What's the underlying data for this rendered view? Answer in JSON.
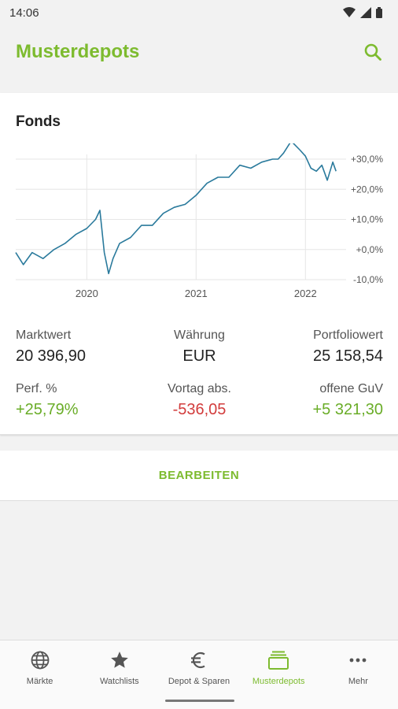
{
  "status": {
    "time": "14:06"
  },
  "header": {
    "title": "Musterdepots"
  },
  "card": {
    "title": "Fonds",
    "stats": [
      {
        "label": "Marktwert",
        "value": "20 396,90",
        "tone": "neutral"
      },
      {
        "label": "Währung",
        "value": "EUR",
        "tone": "neutral"
      },
      {
        "label": "Portfoliowert",
        "value": "25 158,54",
        "tone": "neutral"
      },
      {
        "label": "Perf. %",
        "value": "+25,79%",
        "tone": "pos"
      },
      {
        "label": "Vortag abs.",
        "value": "-536,05",
        "tone": "neg"
      },
      {
        "label": "offene GuV",
        "value": "+5 321,30",
        "tone": "pos"
      }
    ]
  },
  "edit_label": "BEARBEITEN",
  "nav": [
    {
      "label": "Märkte",
      "icon": "globe-icon",
      "active": false
    },
    {
      "label": "Watchlists",
      "icon": "star-icon",
      "active": false
    },
    {
      "label": "Depot & Sparen",
      "icon": "euro-icon",
      "active": false
    },
    {
      "label": "Musterdepots",
      "icon": "folder-stack-icon",
      "active": true
    },
    {
      "label": "Mehr",
      "icon": "more-dots-icon",
      "active": false
    }
  ],
  "colors": {
    "accent": "#7dbb2f",
    "line": "#2a7a9c",
    "positive": "#6aad28",
    "negative": "#d23c3c"
  },
  "chart_data": {
    "type": "line",
    "x_ticks": [
      "2020",
      "2021",
      "2022"
    ],
    "y_ticks": [
      "+30,0%",
      "+20,0%",
      "+10,0%",
      "+0,0%",
      "-10,0%"
    ],
    "y_tick_values": [
      30,
      20,
      10,
      0,
      -10
    ],
    "ylim": [
      -10,
      30
    ],
    "xlim": [
      2019.35,
      2022.3
    ],
    "y_axis_position": "right",
    "grid": true,
    "series": [
      {
        "x": [
          2019.35,
          2019.42,
          2019.5,
          2019.6,
          2019.7,
          2019.8,
          2019.9,
          2020.0,
          2020.08,
          2020.12,
          2020.16,
          2020.2,
          2020.24,
          2020.3,
          2020.4,
          2020.5,
          2020.6,
          2020.7,
          2020.8,
          2020.9,
          2021.0,
          2021.1,
          2021.2,
          2021.3,
          2021.4,
          2021.5,
          2021.6,
          2021.7,
          2021.75,
          2021.8,
          2021.87,
          2021.95,
          2022.0,
          2022.05,
          2022.1,
          2022.15,
          2022.2,
          2022.25,
          2022.28
        ],
        "values": [
          -1,
          -5,
          -1,
          -3,
          0,
          2,
          5,
          7,
          10,
          13,
          -1,
          -8,
          -3,
          2,
          4,
          8,
          8,
          12,
          14,
          15,
          18,
          22,
          24,
          24,
          28,
          27,
          29,
          30,
          30,
          32,
          36,
          33,
          31,
          27,
          26,
          28,
          23,
          29,
          26
        ]
      }
    ]
  }
}
